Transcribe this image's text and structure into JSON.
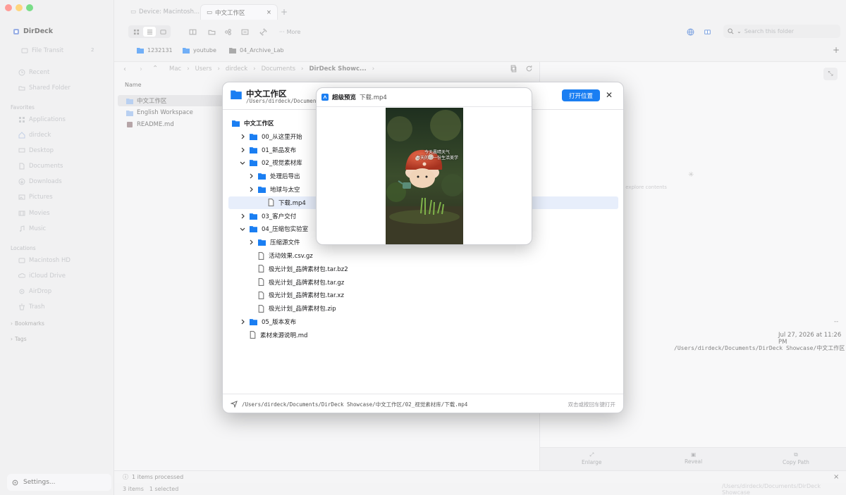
{
  "app": {
    "name": "DirDeck"
  },
  "tabs": [
    {
      "label": "Device: Macintosh..."
    },
    {
      "label": "中文工作区"
    }
  ],
  "toolbar": {
    "more_label": "More",
    "search_placeholder": "Search this folder"
  },
  "favorites_bar": [
    {
      "label": "1232131"
    },
    {
      "label": "youtube"
    },
    {
      "label": "04_Archive_Lab"
    }
  ],
  "sidebar": {
    "file_transit": {
      "label": "File Transit",
      "badge": "2"
    },
    "top_items": [
      {
        "label": "Recent",
        "icon": "clock-icon"
      },
      {
        "label": "Shared Folder",
        "icon": "folder-icon"
      }
    ],
    "favorites_heading": "Favorites",
    "favorites": [
      {
        "label": "Applications",
        "icon": "grid-icon"
      },
      {
        "label": "dirdeck",
        "icon": "home-icon"
      },
      {
        "label": "Desktop",
        "icon": "desktop-icon"
      },
      {
        "label": "Documents",
        "icon": "document-icon"
      },
      {
        "label": "Downloads",
        "icon": "download-icon"
      },
      {
        "label": "Pictures",
        "icon": "image-icon"
      },
      {
        "label": "Movies",
        "icon": "film-icon"
      },
      {
        "label": "Music",
        "icon": "music-icon"
      }
    ],
    "locations_heading": "Locations",
    "locations": [
      {
        "label": "Macintosh HD",
        "icon": "disk-icon"
      },
      {
        "label": "iCloud Drive",
        "icon": "cloud-icon"
      },
      {
        "label": "AirDrop",
        "icon": "airdrop-icon"
      },
      {
        "label": "Trash",
        "icon": "trash-icon"
      }
    ],
    "bookmarks_label": "Bookmarks",
    "tags_label": "Tags",
    "settings_label": "Settings..."
  },
  "breadcrumb": [
    "Mac",
    "Users",
    "dirdeck",
    "Documents",
    "DirDeck Showc..."
  ],
  "file_list": {
    "column_name": "Name",
    "rows": [
      {
        "name": "中文工作区",
        "kind": "folder",
        "selected": true
      },
      {
        "name": "English Workspace",
        "kind": "folder",
        "selected": false
      },
      {
        "name": "README.md",
        "kind": "markdown",
        "selected": false
      }
    ]
  },
  "preview_pane": {
    "explore_hint": "to explore contents",
    "size": "--",
    "modified": "Jul 27, 2026 at 11:26 PM",
    "path": "/Users/dirdeck/Documents/DirDeck Showcase/中文工作区",
    "actions": [
      {
        "label": "Enlarge"
      },
      {
        "label": "Reveal"
      },
      {
        "label": "Copy Path"
      }
    ]
  },
  "status": {
    "processed": "1 items processed",
    "items": "3 items",
    "selected": "1 selected",
    "path_faint": "/Users/dirdeck/Documents/DirDeck Showcase"
  },
  "modal": {
    "title": "中文工作区",
    "path": "/Users/dirdeck/Documents",
    "open_button": "打开位置",
    "tree": [
      {
        "label": "中文工作区",
        "kind": "folder",
        "depth": 0,
        "chev": "none",
        "bold": true
      },
      {
        "label": "00_从这里开始",
        "kind": "folder",
        "depth": 1,
        "chev": "right"
      },
      {
        "label": "01_新品发布",
        "kind": "folder",
        "depth": 1,
        "chev": "right"
      },
      {
        "label": "02_视觉素材库",
        "kind": "folder",
        "depth": 1,
        "chev": "down"
      },
      {
        "label": "处理后导出",
        "kind": "folder",
        "depth": 2,
        "chev": "right"
      },
      {
        "label": "地球与太空",
        "kind": "folder",
        "depth": 2,
        "chev": "right"
      },
      {
        "label": "下载.mp4",
        "kind": "file",
        "depth": 2,
        "chev": "none",
        "highlight": true
      },
      {
        "label": "03_客户交付",
        "kind": "folder",
        "depth": 1,
        "chev": "right"
      },
      {
        "label": "04_压缩包实验室",
        "kind": "folder",
        "depth": 1,
        "chev": "down"
      },
      {
        "label": "压缩源文件",
        "kind": "folder",
        "depth": 2,
        "chev": "right"
      },
      {
        "label": "活动效果.csv.gz",
        "kind": "file",
        "depth": 2,
        "chev": "none"
      },
      {
        "label": "极光计划_品牌素材包.tar.bz2",
        "kind": "file",
        "depth": 2,
        "chev": "none"
      },
      {
        "label": "极光计划_品牌素材包.tar.gz",
        "kind": "file",
        "depth": 2,
        "chev": "none"
      },
      {
        "label": "极光计划_品牌素材包.tar.xz",
        "kind": "file",
        "depth": 2,
        "chev": "none"
      },
      {
        "label": "极光计划_品牌素材包.zip",
        "kind": "file",
        "depth": 2,
        "chev": "none"
      },
      {
        "label": "05_版本发布",
        "kind": "folder",
        "depth": 1,
        "chev": "right"
      },
      {
        "label": "素材来源说明.md",
        "kind": "file",
        "depth": 1,
        "chev": "none"
      }
    ],
    "footer_path": "/Users/dirdeck/Documents/DirDeck Showcase/中文工作区/02_视觉素材库/下载.mp4",
    "footer_hint": "双击或按回车键打开"
  },
  "quicklook": {
    "title": "超级预览",
    "filename": "下载.mp4",
    "caption_line1": "今天晨晴天气",
    "caption_line2": "春天的第一份生活美学"
  },
  "colors": {
    "accent": "#1a7ef2",
    "folder": "#1a7ef2"
  }
}
